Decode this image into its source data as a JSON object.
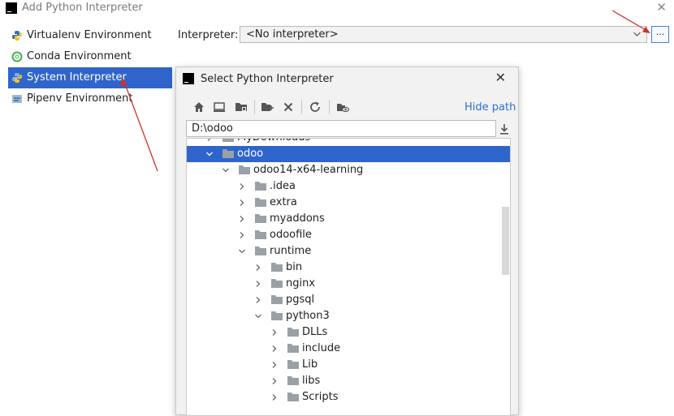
{
  "window": {
    "title": "Add Python Interpreter",
    "close_glyph": "✕",
    "logo_text": "PC"
  },
  "sidebar": {
    "items": [
      {
        "label": "Virtualenv Environment",
        "icon": "virtualenv-icon",
        "selected": false
      },
      {
        "label": "Conda Environment",
        "icon": "conda-icon",
        "selected": false
      },
      {
        "label": "System Interpreter",
        "icon": "python-icon",
        "selected": true
      },
      {
        "label": "Pipenv Environment",
        "icon": "pipenv-icon",
        "selected": false
      }
    ]
  },
  "interpreter": {
    "label": "Interpreter:",
    "value": "<No interpreter>",
    "browse_label": "..."
  },
  "dialog": {
    "title": "Select Python Interpreter",
    "close_glyph": "✕",
    "hide_path_label": "Hide path",
    "path_value": "D:\\odoo",
    "toolbar_icons": [
      "home-icon",
      "desktop-icon",
      "project-folder-icon",
      "new-folder-icon",
      "delete-icon",
      "refresh-icon",
      "show-hidden-icon"
    ],
    "tree": [
      {
        "label": "MyDownloads",
        "depth": 1,
        "expanded": false,
        "selected": false
      },
      {
        "label": "odoo",
        "depth": 1,
        "expanded": true,
        "selected": true
      },
      {
        "label": "odoo14-x64-learning",
        "depth": 2,
        "expanded": true,
        "selected": false
      },
      {
        "label": ".idea",
        "depth": 3,
        "expanded": false,
        "selected": false
      },
      {
        "label": "extra",
        "depth": 3,
        "expanded": false,
        "selected": false
      },
      {
        "label": "myaddons",
        "depth": 3,
        "expanded": false,
        "selected": false
      },
      {
        "label": "odoofile",
        "depth": 3,
        "expanded": false,
        "selected": false
      },
      {
        "label": "runtime",
        "depth": 3,
        "expanded": true,
        "selected": false
      },
      {
        "label": "bin",
        "depth": 4,
        "expanded": false,
        "selected": false
      },
      {
        "label": "nginx",
        "depth": 4,
        "expanded": false,
        "selected": false
      },
      {
        "label": "pgsql",
        "depth": 4,
        "expanded": false,
        "selected": false
      },
      {
        "label": "python3",
        "depth": 4,
        "expanded": true,
        "selected": false
      },
      {
        "label": "DLLs",
        "depth": 5,
        "expanded": false,
        "selected": false
      },
      {
        "label": "include",
        "depth": 5,
        "expanded": false,
        "selected": false
      },
      {
        "label": "Lib",
        "depth": 5,
        "expanded": false,
        "selected": false
      },
      {
        "label": "libs",
        "depth": 5,
        "expanded": false,
        "selected": false
      },
      {
        "label": "Scripts",
        "depth": 5,
        "expanded": false,
        "selected": false
      }
    ]
  },
  "colors": {
    "selection": "#2f65ca",
    "link": "#2d6fd6",
    "folder": "#9aa0a6",
    "annotation_arrow": "#d0312d"
  }
}
